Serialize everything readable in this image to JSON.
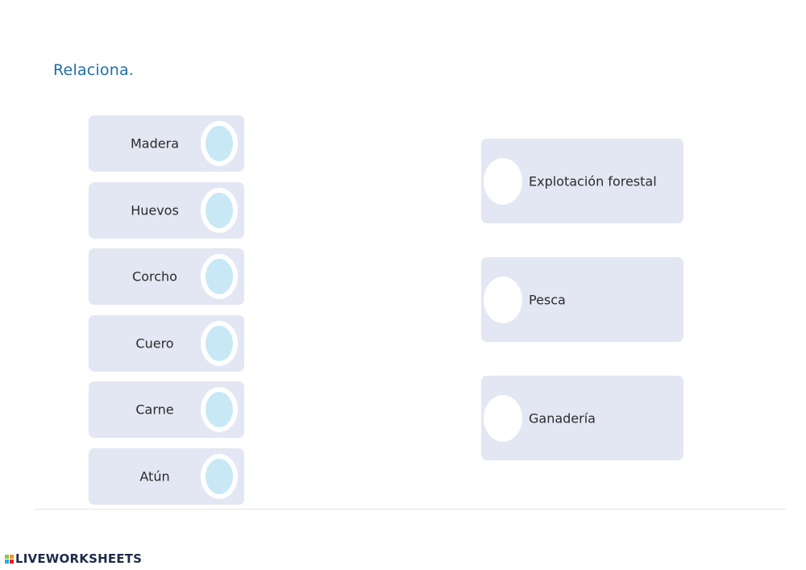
{
  "instruction": "Relaciona.",
  "left_items": [
    {
      "label": "Madera"
    },
    {
      "label": "Huevos"
    },
    {
      "label": "Corcho"
    },
    {
      "label": "Cuero"
    },
    {
      "label": "Carne"
    },
    {
      "label": "Atún"
    }
  ],
  "right_items": [
    {
      "label": "Explotación forestal"
    },
    {
      "label": "Pesca"
    },
    {
      "label": "Ganadería"
    }
  ],
  "footer": {
    "logo_text": "LIVEWORKSHEETS"
  },
  "colors": {
    "instruction": "#1f6fa6",
    "card_bg": "#e3e6f3",
    "left_dot": "#c9e8f6",
    "right_dot": "#ffffff",
    "logo_green": "#8cc63f",
    "logo_orange": "#f7931e",
    "logo_blue": "#29abe2",
    "logo_red": "#ed1c24"
  }
}
